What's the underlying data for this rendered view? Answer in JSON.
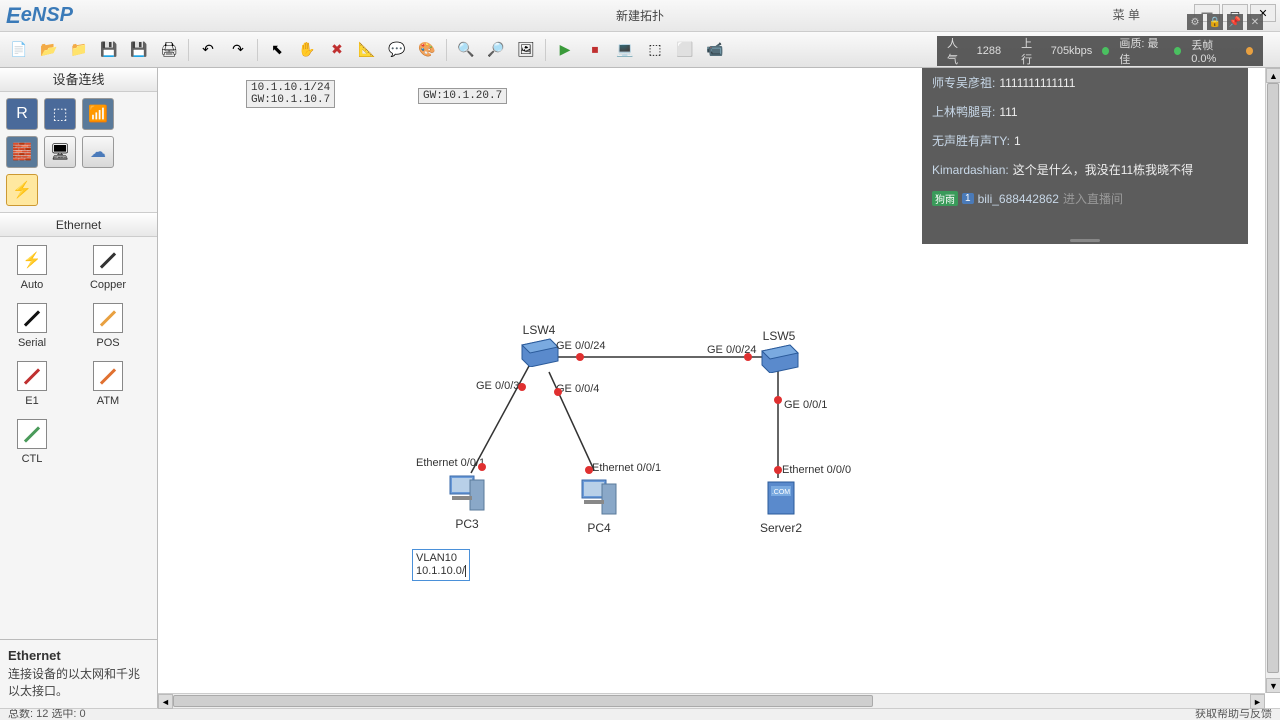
{
  "titlebar": {
    "logo": "eNSP",
    "title": "新建拓扑",
    "menu": "菜 单"
  },
  "toolbar_icons": [
    "📄",
    "📂",
    "📁",
    "💾",
    "💾",
    "🖨",
    "↶",
    "↷",
    "⬉",
    "✋",
    "✖",
    "📐",
    "💬",
    "📋",
    "🔍",
    "🔎",
    "🖼",
    "▶",
    "⏹",
    "💻",
    "⬚",
    "⬜",
    "📹"
  ],
  "left": {
    "header": "设备连线",
    "section": "Ethernet",
    "devices": [
      {
        "label": "Auto",
        "kind": "auto"
      },
      {
        "label": "Copper",
        "kind": "copper"
      },
      {
        "label": "Serial",
        "kind": "serial"
      },
      {
        "label": "POS",
        "kind": "pos"
      },
      {
        "label": "E1",
        "kind": "e1"
      },
      {
        "label": "ATM",
        "kind": "atm"
      },
      {
        "label": "CTL",
        "kind": "ctl"
      }
    ],
    "desc_title": "Ethernet",
    "desc_body": "连接设备的以太网和千兆以太接口。"
  },
  "canvas": {
    "note1": "10.1.10.1/24\nGW:10.1.10.7",
    "note2": "GW:10.1.20.7",
    "edit_note": "VLAN10\n10.1.10.0/",
    "nodes": {
      "lsw4": "LSW4",
      "lsw5": "LSW5",
      "pc3": "PC3",
      "pc4": "PC4",
      "server2": "Server2"
    },
    "ports": {
      "ge0024_a": "GE 0/0/24",
      "ge0024_b": "GE 0/0/24",
      "ge003": "GE 0/0/3",
      "ge004": "GE 0/0/4",
      "ge001": "GE 0/0/1",
      "eth001_a": "Ethernet 0/0/1",
      "eth001_b": "Ethernet 0/0/1",
      "eth000": "Ethernet 0/0/0"
    }
  },
  "overlay": {
    "pop_label": "人气",
    "pop_val": "1288",
    "up_label": "上行",
    "up_val": "705kbps",
    "qual_label": "画质: 最佳",
    "drop_label": "丢帧 0.0%",
    "lines": [
      {
        "name": "师专吴彦祖:",
        "msg": "1111111111111"
      },
      {
        "name": "上林鸭腿哥:",
        "msg": "111"
      },
      {
        "name": "无声胜有声TY:",
        "msg": "1"
      },
      {
        "name": "Kimardashian:",
        "msg": "这个是什么，我没在11栋我晓不得"
      },
      {
        "tag1": "狗雨",
        "tag2": "1",
        "name": "bili_688442862",
        "sys": "进入直播间"
      }
    ]
  },
  "status": {
    "left": "总数: 12 选中: 0",
    "right": "获取帮助与反馈"
  }
}
